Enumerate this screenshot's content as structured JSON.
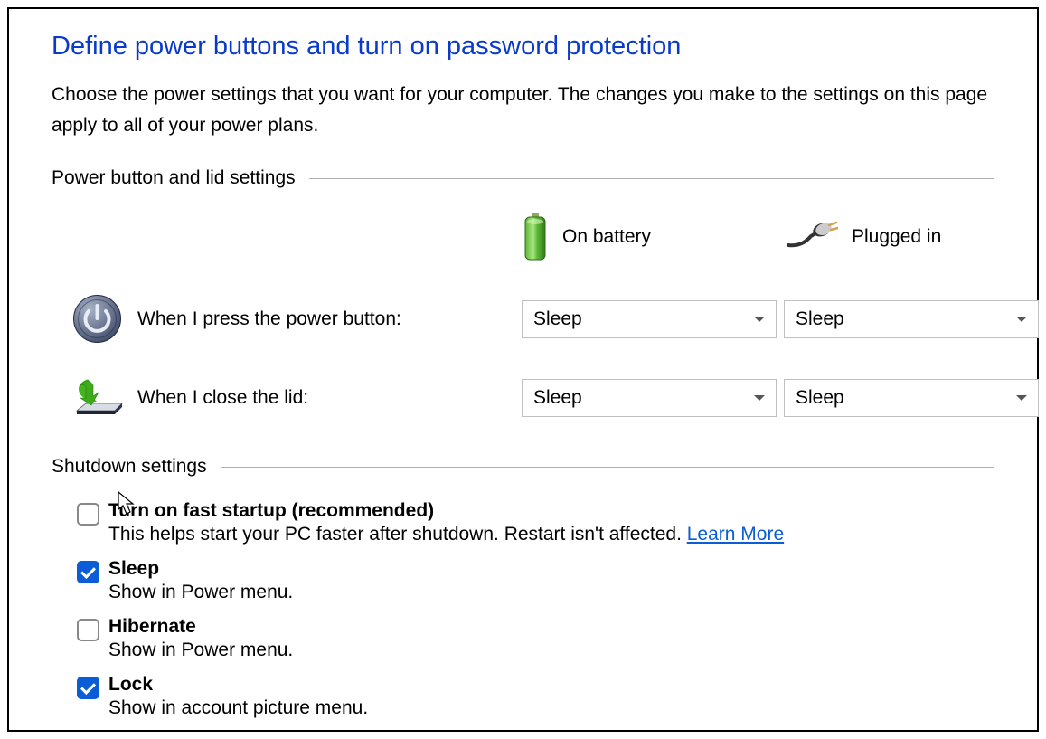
{
  "page_title": "Define power buttons and turn on password protection",
  "description": "Choose the power settings that you want for your computer. The changes you make to the settings on this page apply to all of your power plans.",
  "sections": {
    "power_button_lid": {
      "title": "Power button and lid settings",
      "columns": {
        "battery": "On battery",
        "plugged": "Plugged in"
      },
      "rows": {
        "power_button": {
          "label": "When I press the power button:",
          "battery_value": "Sleep",
          "plugged_value": "Sleep"
        },
        "close_lid": {
          "label": "When I close the lid:",
          "battery_value": "Sleep",
          "plugged_value": "Sleep"
        }
      }
    },
    "shutdown": {
      "title": "Shutdown settings",
      "items": {
        "fast_startup": {
          "label": "Turn on fast startup (recommended)",
          "description": "This helps start your PC faster after shutdown. Restart isn't affected. ",
          "learn_more": "Learn More",
          "checked": false
        },
        "sleep": {
          "label": "Sleep",
          "description": "Show in Power menu.",
          "checked": true
        },
        "hibernate": {
          "label": "Hibernate",
          "description": "Show in Power menu.",
          "checked": false
        },
        "lock": {
          "label": "Lock",
          "description": "Show in account picture menu.",
          "checked": true
        }
      }
    }
  }
}
